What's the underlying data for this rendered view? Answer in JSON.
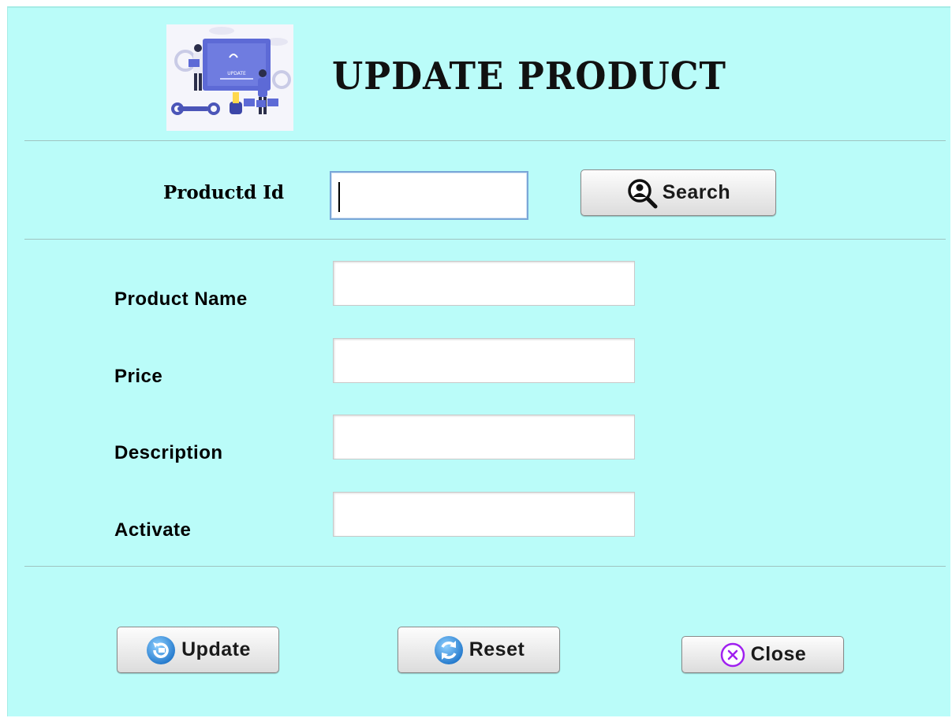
{
  "header": {
    "title": "UPDATE PRODUCT",
    "logo_caption": "UPDATE"
  },
  "search": {
    "label": "Productd Id",
    "value": "",
    "button_label": "Search",
    "button_icon": "search-person-icon"
  },
  "form": {
    "fields": [
      {
        "label": "Product Name",
        "value": ""
      },
      {
        "label": "Price",
        "value": ""
      },
      {
        "label": "Description",
        "value": ""
      },
      {
        "label": "Activate",
        "value": ""
      }
    ]
  },
  "actions": {
    "update_label": "Update",
    "update_icon": "update-icon",
    "reset_label": "Reset",
    "reset_icon": "refresh-icon",
    "close_label": "Close",
    "close_icon": "close-circle-icon"
  },
  "colors": {
    "background": "#bafcf9",
    "update_icon": "#2f8fe0",
    "reset_icon": "#2f8fe0",
    "close_icon": "#a020f0"
  }
}
